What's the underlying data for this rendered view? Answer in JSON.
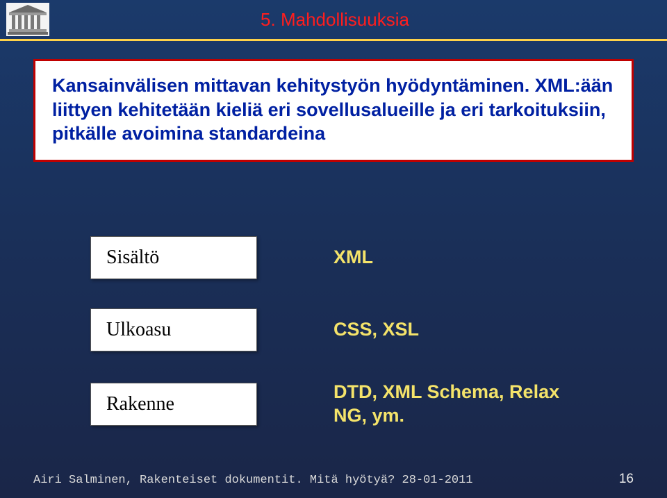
{
  "header": {
    "title": "5. Mahdollisuuksia"
  },
  "mainBox": {
    "line1": "Kansainvälisen mittavan kehitystyön hyödyntäminen.",
    "line2": "XML:ään liittyen kehitetään kieliä eri sovellusalueille ja eri tarkoituksiin, pitkälle avoimina standardeina"
  },
  "rows": {
    "r1": {
      "box": "Sisältö",
      "label": "XML"
    },
    "r2": {
      "box": "Ulkoasu",
      "label": "CSS, XSL"
    },
    "r3": {
      "box": "Rakenne",
      "label": "DTD, XML Schema, Relax NG, ym."
    }
  },
  "footer": {
    "text": "Airi Salminen, Rakenteiset dokumentit. Mitä hyötyä? 28-01-2011",
    "page": "16"
  }
}
